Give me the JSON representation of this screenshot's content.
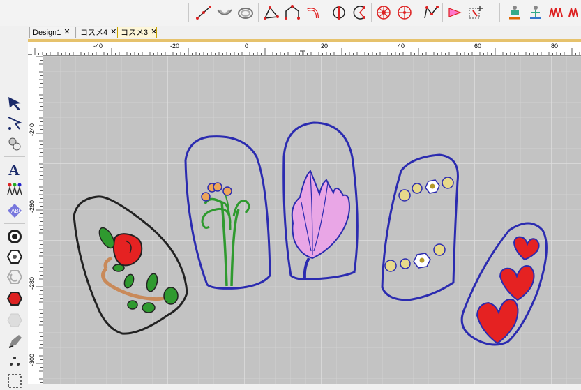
{
  "tabs": [
    {
      "label": "Design1",
      "close": "✕",
      "active": false
    },
    {
      "label": "コスメ4",
      "close": "✕",
      "active": false
    },
    {
      "label": "コスメ3",
      "close": "✕",
      "active": true
    }
  ],
  "ruler_top_labels": [
    "-40",
    "-20",
    "0",
    "20",
    "40",
    "60",
    "80"
  ],
  "ruler_left_labels": [
    "-240",
    "-260",
    "-280",
    "-300"
  ],
  "toolbar_icons": [
    "line-tool-icon",
    "arc-open-icon",
    "arc-closed-icon",
    "polygon-tool-icon",
    "house-shape-icon",
    "curve-tool-icon",
    "half-circle-icon",
    "arc-segment-icon",
    "circle-radial-icon",
    "circle-cross-icon",
    "zigzag-icon",
    "flag-tool-icon",
    "transform-tool-icon",
    "embroidery-figure-icon",
    "stitch-figure-icon",
    "wave-stitch-icon",
    "wave-stitch-2-icon"
  ],
  "left_tool_icons": [
    "select-arrow-icon",
    "edit-points-icon",
    "rotate-tool-icon",
    "text-tool-icon",
    "people-tool-icon",
    "monogram-tool-icon",
    "circle-target-icon",
    "hexagon-outline-icon",
    "arc-shape-icon",
    "hexagon-filled-icon",
    "hexagon-gray-icon",
    "pen-tool-icon",
    "dots-tool-icon",
    "select-box-icon"
  ],
  "colors": {
    "canvas": "#c3c3c3",
    "grid": "#d9d9d9",
    "blue_outline": "#2b2bb0",
    "black_outline": "#222222",
    "red": "#e52222",
    "green": "#2f9a2f",
    "pink": "#e9a6e6",
    "gold": "#e6c26c"
  }
}
